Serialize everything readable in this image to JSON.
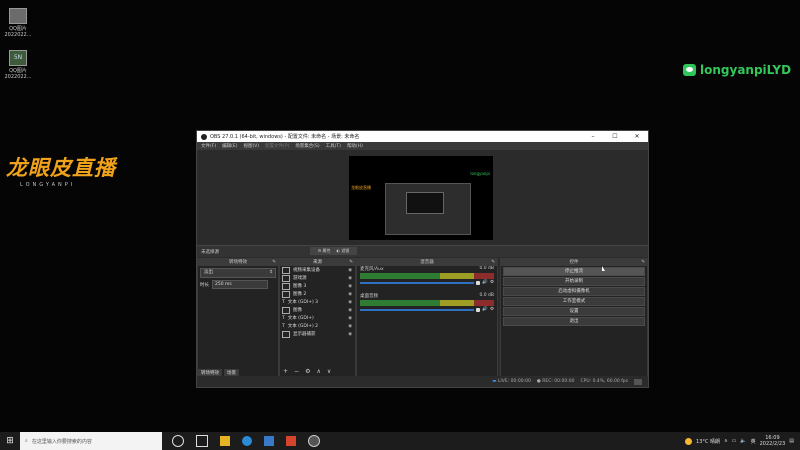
{
  "desktop": {
    "icons": [
      {
        "label_line1": "QQ图片",
        "label_line2": "2022022...",
        "thumb": ""
      },
      {
        "label_line1": "QQ图片",
        "label_line2": "2022022...",
        "thumb": "5N"
      }
    ],
    "left_logo": {
      "main": "龙眼皮直播",
      "sub": "LONGYANPI"
    },
    "right_logo": {
      "text": "longyanpiLYD",
      "icon": "wechat-icon",
      "color": "#34c759"
    }
  },
  "obs": {
    "title": "OBS 27.0.1 (64-bit, windows) - 配置文件: 未命名 - 场景: 未命名",
    "menu": [
      "文件(F)",
      "编辑(E)",
      "视图(V)",
      "配置文件(P)",
      "场景集合(S)",
      "工具(T)",
      "帮助(H)"
    ],
    "preview": {
      "overlay_left": "龙眼皮直播",
      "overlay_right": "longyanpi"
    },
    "scene_bar": {
      "label": "未选择源",
      "properties": "属性",
      "filters": "滤镜"
    },
    "transitions": {
      "header": "转场特效",
      "selected": "淡出",
      "duration_label": "时长",
      "duration_value": "250 ms"
    },
    "scenes_tabs": [
      "转场特效",
      "场景"
    ],
    "sources": {
      "header": "来源",
      "items": [
        "视频采集设备",
        "游戏源",
        "图像 3",
        "图像 2",
        "文本 (GDI+) 3",
        "图像",
        "文本 (GDI+)",
        "文本 (GDI+) 2",
        "显示器捕获"
      ],
      "toolbar": [
        "+",
        "−",
        "⚙",
        "∧",
        "∨"
      ]
    },
    "mixer": {
      "header": "混音器",
      "channels": [
        {
          "name": "麦克风/Aux",
          "db": "0.0 dB"
        },
        {
          "name": "桌面音频",
          "db": "0.0 dB"
        }
      ]
    },
    "controls": {
      "header": "控件",
      "buttons": [
        "停止推流",
        "开始录制",
        "启动虚拟摄像机",
        "工作室模式",
        "设置",
        "退出"
      ]
    },
    "status": {
      "live": "LIVE: 00:00:00",
      "rec": "REC: 00:00:00",
      "cpu": "CPU: 0.4%, 60.00 fps"
    }
  },
  "taskbar": {
    "search_placeholder": "在这里输入你要搜索的内容",
    "weather": "13°C 晴朗",
    "time": "16:09",
    "date": "2022/2/23",
    "ime": "英"
  }
}
